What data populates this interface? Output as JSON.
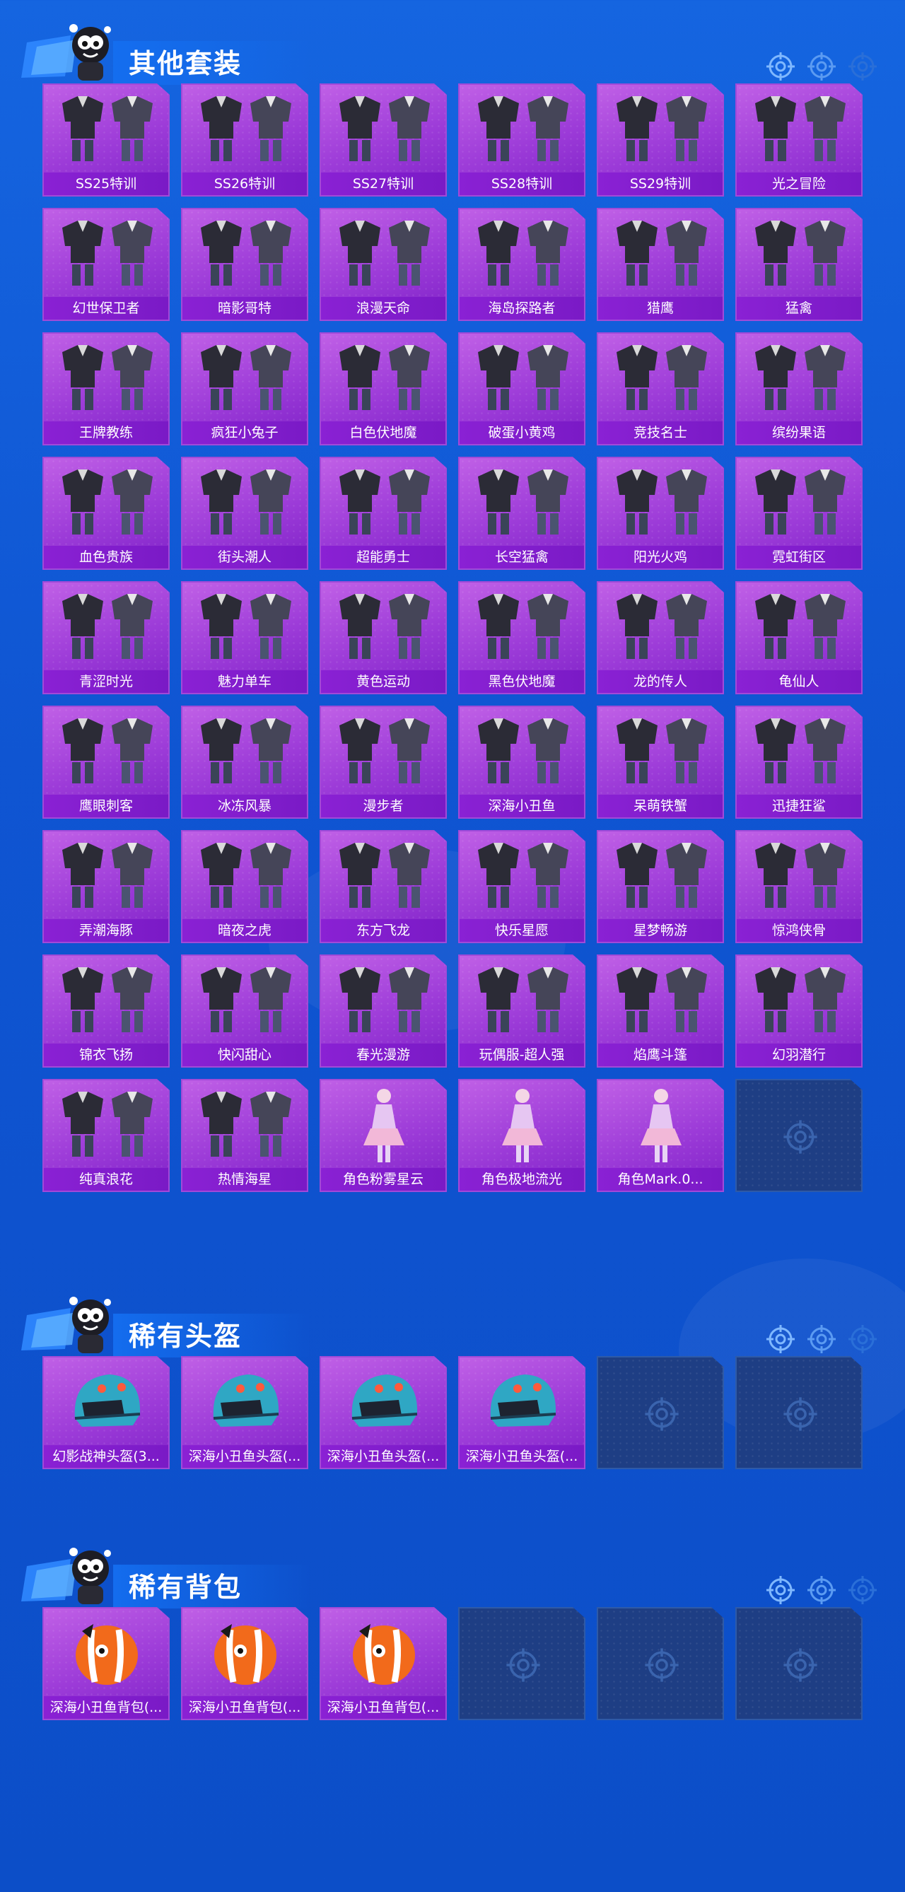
{
  "sections": [
    {
      "title": "其他套装",
      "cells": [
        {
          "label": "SS25特训",
          "kind": "suit"
        },
        {
          "label": "SS26特训",
          "kind": "suit"
        },
        {
          "label": "SS27特训",
          "kind": "suit"
        },
        {
          "label": "SS28特训",
          "kind": "suit"
        },
        {
          "label": "SS29特训",
          "kind": "suit"
        },
        {
          "label": "光之冒险",
          "kind": "suit"
        },
        {
          "label": "幻世保卫者",
          "kind": "suit"
        },
        {
          "label": "暗影哥特",
          "kind": "suit"
        },
        {
          "label": "浪漫天命",
          "kind": "suit"
        },
        {
          "label": "海岛探路者",
          "kind": "suit"
        },
        {
          "label": "猎鹰",
          "kind": "suit"
        },
        {
          "label": "猛禽",
          "kind": "suit"
        },
        {
          "label": "王牌教练",
          "kind": "suit"
        },
        {
          "label": "疯狂小兔子",
          "kind": "suit"
        },
        {
          "label": "白色伏地魔",
          "kind": "suit"
        },
        {
          "label": "破蛋小黄鸡",
          "kind": "suit"
        },
        {
          "label": "竞技名士",
          "kind": "suit"
        },
        {
          "label": "缤纷果语",
          "kind": "suit"
        },
        {
          "label": "血色贵族",
          "kind": "suit"
        },
        {
          "label": "街头潮人",
          "kind": "suit"
        },
        {
          "label": "超能勇士",
          "kind": "suit"
        },
        {
          "label": "长空猛禽",
          "kind": "suit"
        },
        {
          "label": "阳光火鸡",
          "kind": "suit"
        },
        {
          "label": "霓虹街区",
          "kind": "suit"
        },
        {
          "label": "青涩时光",
          "kind": "suit"
        },
        {
          "label": "魅力单车",
          "kind": "suit"
        },
        {
          "label": "黄色运动",
          "kind": "suit"
        },
        {
          "label": "黑色伏地魔",
          "kind": "suit"
        },
        {
          "label": "龙的传人",
          "kind": "suit"
        },
        {
          "label": "龟仙人",
          "kind": "suit"
        },
        {
          "label": "鹰眼刺客",
          "kind": "suit"
        },
        {
          "label": "冰冻风暴",
          "kind": "suit"
        },
        {
          "label": "漫步者",
          "kind": "suit"
        },
        {
          "label": "深海小丑鱼",
          "kind": "suit"
        },
        {
          "label": "呆萌铁蟹",
          "kind": "suit"
        },
        {
          "label": "迅捷狂鲨",
          "kind": "suit"
        },
        {
          "label": "弄潮海豚",
          "kind": "suit"
        },
        {
          "label": "暗夜之虎",
          "kind": "suit"
        },
        {
          "label": "东方飞龙",
          "kind": "suit"
        },
        {
          "label": "快乐星愿",
          "kind": "suit"
        },
        {
          "label": "星梦畅游",
          "kind": "suit"
        },
        {
          "label": "惊鸿侠骨",
          "kind": "suit"
        },
        {
          "label": "锦衣飞扬",
          "kind": "suit"
        },
        {
          "label": "快闪甜心",
          "kind": "suit"
        },
        {
          "label": "春光漫游",
          "kind": "suit"
        },
        {
          "label": "玩偶服-超人强",
          "kind": "suit"
        },
        {
          "label": "焰鹰斗篷",
          "kind": "suit"
        },
        {
          "label": "幻羽潜行",
          "kind": "suit"
        },
        {
          "label": "纯真浪花",
          "kind": "suit"
        },
        {
          "label": "热情海星",
          "kind": "suit"
        },
        {
          "label": "角色粉雾星云",
          "kind": "figure"
        },
        {
          "label": "角色极地流光",
          "kind": "figure"
        },
        {
          "label": "角色Mark.0...",
          "kind": "figure"
        },
        {
          "empty": true
        }
      ]
    },
    {
      "title": "稀有头盔",
      "cells": [
        {
          "label": "幻影战神头盔(3...",
          "kind": "helmet"
        },
        {
          "label": "深海小丑鱼头盔(...",
          "kind": "helmet"
        },
        {
          "label": "深海小丑鱼头盔(...",
          "kind": "helmet"
        },
        {
          "label": "深海小丑鱼头盔(...",
          "kind": "helmet"
        },
        {
          "empty": true
        },
        {
          "empty": true
        }
      ]
    },
    {
      "title": "稀有背包",
      "cells": [
        {
          "label": "深海小丑鱼背包(...",
          "kind": "backpack"
        },
        {
          "label": "深海小丑鱼背包(...",
          "kind": "backpack"
        },
        {
          "label": "深海小丑鱼背包(...",
          "kind": "backpack"
        },
        {
          "empty": true
        },
        {
          "empty": true
        },
        {
          "empty": true
        }
      ]
    }
  ]
}
